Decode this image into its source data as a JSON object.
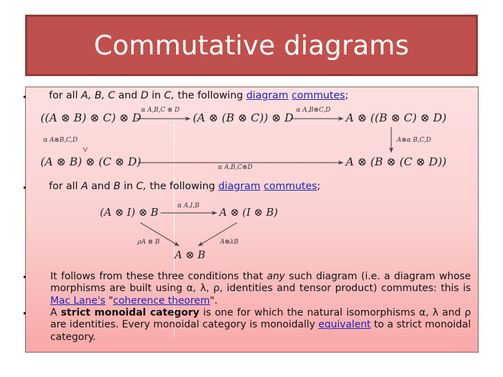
{
  "slide": {
    "title": "Commutative diagrams",
    "colors": {
      "title_bg": "#c0504d",
      "title_border": "#8c3a38",
      "link": "#1f1fbf",
      "content_top": "#fde0e0",
      "content_bottom": "#f9a8a8"
    }
  },
  "bullets": [
    {
      "dot": "•",
      "pre": "for all ",
      "vars1": "A, B, C",
      "mid1": " and ",
      "var2": "D",
      "mid2": " in ",
      "var3": "C,",
      "post": " the following ",
      "link1": "diagram",
      "space": " ",
      "link2": "commutes",
      "end": ";"
    },
    {
      "dot": "•",
      "pre": "for all ",
      "var1": "A",
      "mid1": " and ",
      "var2": "B",
      "mid2": " in ",
      "var3": "C,",
      "post": " the following ",
      "link1": "diagram",
      "space": " ",
      "link2": "commutes",
      "end": ";"
    },
    {
      "dot": "•",
      "text_a": "It follows from these three conditions that ",
      "text_any": "any",
      "text_b": " such diagram (i.e. a diagram whose morphisms are built using α, λ, ρ, identities and tensor product) commutes: this is ",
      "link_maclane": "Mac Lane's",
      "text_c": " \"",
      "link_coherence": "coherence theorem",
      "text_d": "\"."
    },
    {
      "dot": "•",
      "text_a": "A ",
      "bold": "strict monoidal category",
      "text_b": " is one for which the natural isomorphisms α, λ and ρ are identities. Every monoidal category is monoidally ",
      "link_equivalent": "equivalent",
      "text_c": " to a strict monoidal category."
    }
  ],
  "pentagon": {
    "top_left": "((A ⊗ B) ⊗ C) ⊗ D",
    "top_mid": "(A ⊗ (B ⊗ C)) ⊗ D",
    "top_right": "A ⊗ ((B ⊗ C) ⊗ D)",
    "bottom_left": "(A ⊗ B) ⊗ (C ⊗ D)",
    "bottom_right": "A ⊗ (B ⊗ (C ⊗ D))",
    "label_top1": "α A,B,C ⊗ D",
    "label_top2": "α A,B⊗C,D",
    "label_left": "α A⊗B,C,D",
    "label_right": "A⊗α B,C,D",
    "label_bottom": "α A,B,C⊗D"
  },
  "triangle": {
    "top_left": "(A ⊗ I) ⊗ B",
    "top_right": "A ⊗ (I ⊗ B)",
    "bottom": "A ⊗ B",
    "label_top": "α A,I,B",
    "label_left": "ρA ⊗ B",
    "label_right": "A⊗λB"
  }
}
